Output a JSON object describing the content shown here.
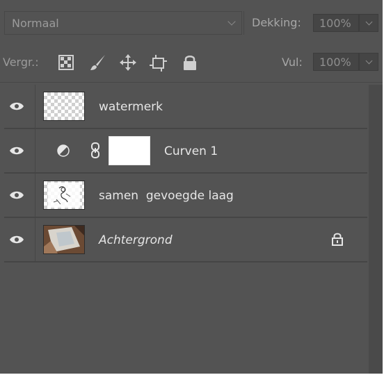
{
  "blend_mode": {
    "value": "Normaal"
  },
  "opacity": {
    "label": "Dekking:",
    "value": "100%"
  },
  "lock": {
    "label": "Vergr.:",
    "icons": [
      "lock-transparency-icon",
      "lock-paint-icon",
      "lock-position-icon",
      "lock-artboard-icon",
      "lock-all-icon"
    ]
  },
  "fill": {
    "label": "Vul:",
    "value": "100%"
  },
  "layers": [
    {
      "name": "watermerk",
      "visible": true,
      "thumb": "transparent-checker"
    },
    {
      "name": "Curven 1",
      "visible": true,
      "thumb": "white-mask",
      "type": "adjustment"
    },
    {
      "name": "samen  gevoegde laag",
      "visible": true,
      "thumb": "sketch"
    },
    {
      "name": "Achtergrond",
      "visible": true,
      "thumb": "photo",
      "locked": true
    }
  ]
}
